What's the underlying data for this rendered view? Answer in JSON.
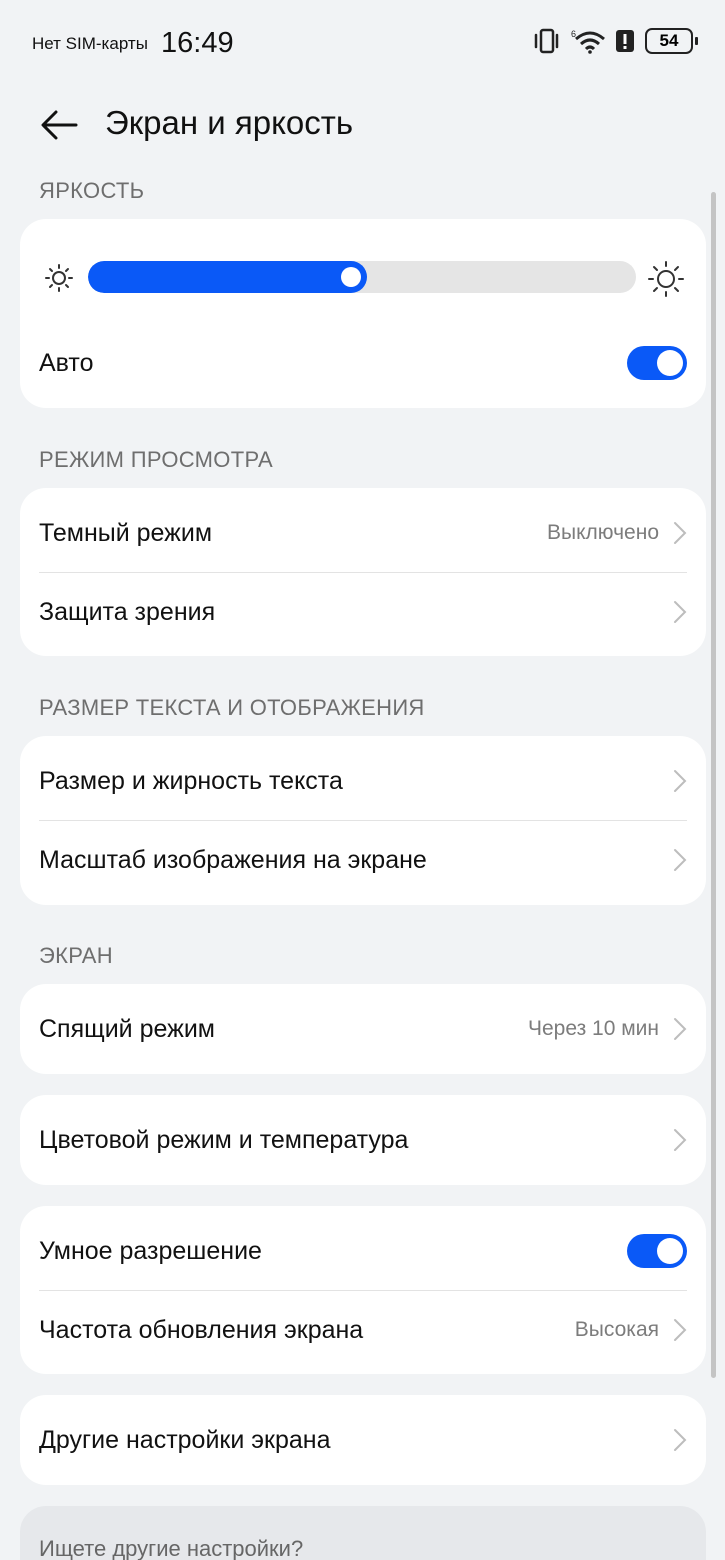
{
  "status_bar": {
    "sim": "Нет SIM-карты",
    "time": "16:49",
    "battery": "54",
    "icons": [
      "vibrate-icon",
      "wifi-icon",
      "alert-icon",
      "battery-icon"
    ]
  },
  "header": {
    "title": "Экран и яркость"
  },
  "brightness": {
    "section": "ЯРКОСТЬ",
    "level_percent": 51,
    "auto_label": "Авто",
    "auto_on": true
  },
  "view_mode": {
    "section": "РЕЖИМ ПРОСМОТРА",
    "dark_mode": {
      "label": "Темный режим",
      "value": "Выключено"
    },
    "eye_comfort": {
      "label": "Защита зрения"
    }
  },
  "text_display": {
    "section": "РАЗМЕР ТЕКСТА И ОТОБРАЖЕНИЯ",
    "text_size": {
      "label": "Размер и жирность текста"
    },
    "display_scale": {
      "label": "Масштаб изображения на экране"
    }
  },
  "screen": {
    "section": "ЭКРАН",
    "sleep": {
      "label": "Спящий режим",
      "value": "Через 10 мин"
    },
    "color_mode": {
      "label": "Цветовой режим и температура"
    },
    "smart_resolution": {
      "label": "Умное разрешение",
      "on": true
    },
    "refresh_rate": {
      "label": "Частота обновления экрана",
      "value": "Высокая"
    },
    "more": {
      "label": "Другие настройки экрана"
    }
  },
  "footer": {
    "prompt": "Ищете другие настройки?"
  },
  "colors": {
    "accent": "#0a59f7",
    "background": "#f1f3f5",
    "card": "#ffffff"
  }
}
